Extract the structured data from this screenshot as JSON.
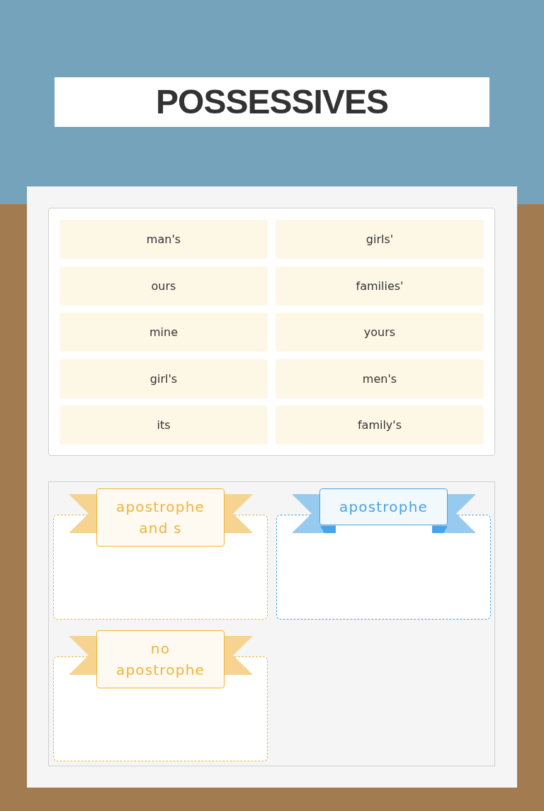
{
  "title": "POSSESSIVES",
  "word_tiles": [
    "man's",
    "girls'",
    "ours",
    "families'",
    "mine",
    "yours",
    "girl's",
    "men's",
    "its",
    "family's"
  ],
  "categories": [
    {
      "label": "apostrophe and s",
      "color": "#f0b33c"
    },
    {
      "label": "apostrophe",
      "color": "#4ba3e3"
    },
    {
      "label": "no apostrophe",
      "color": "#f0b33c"
    }
  ]
}
